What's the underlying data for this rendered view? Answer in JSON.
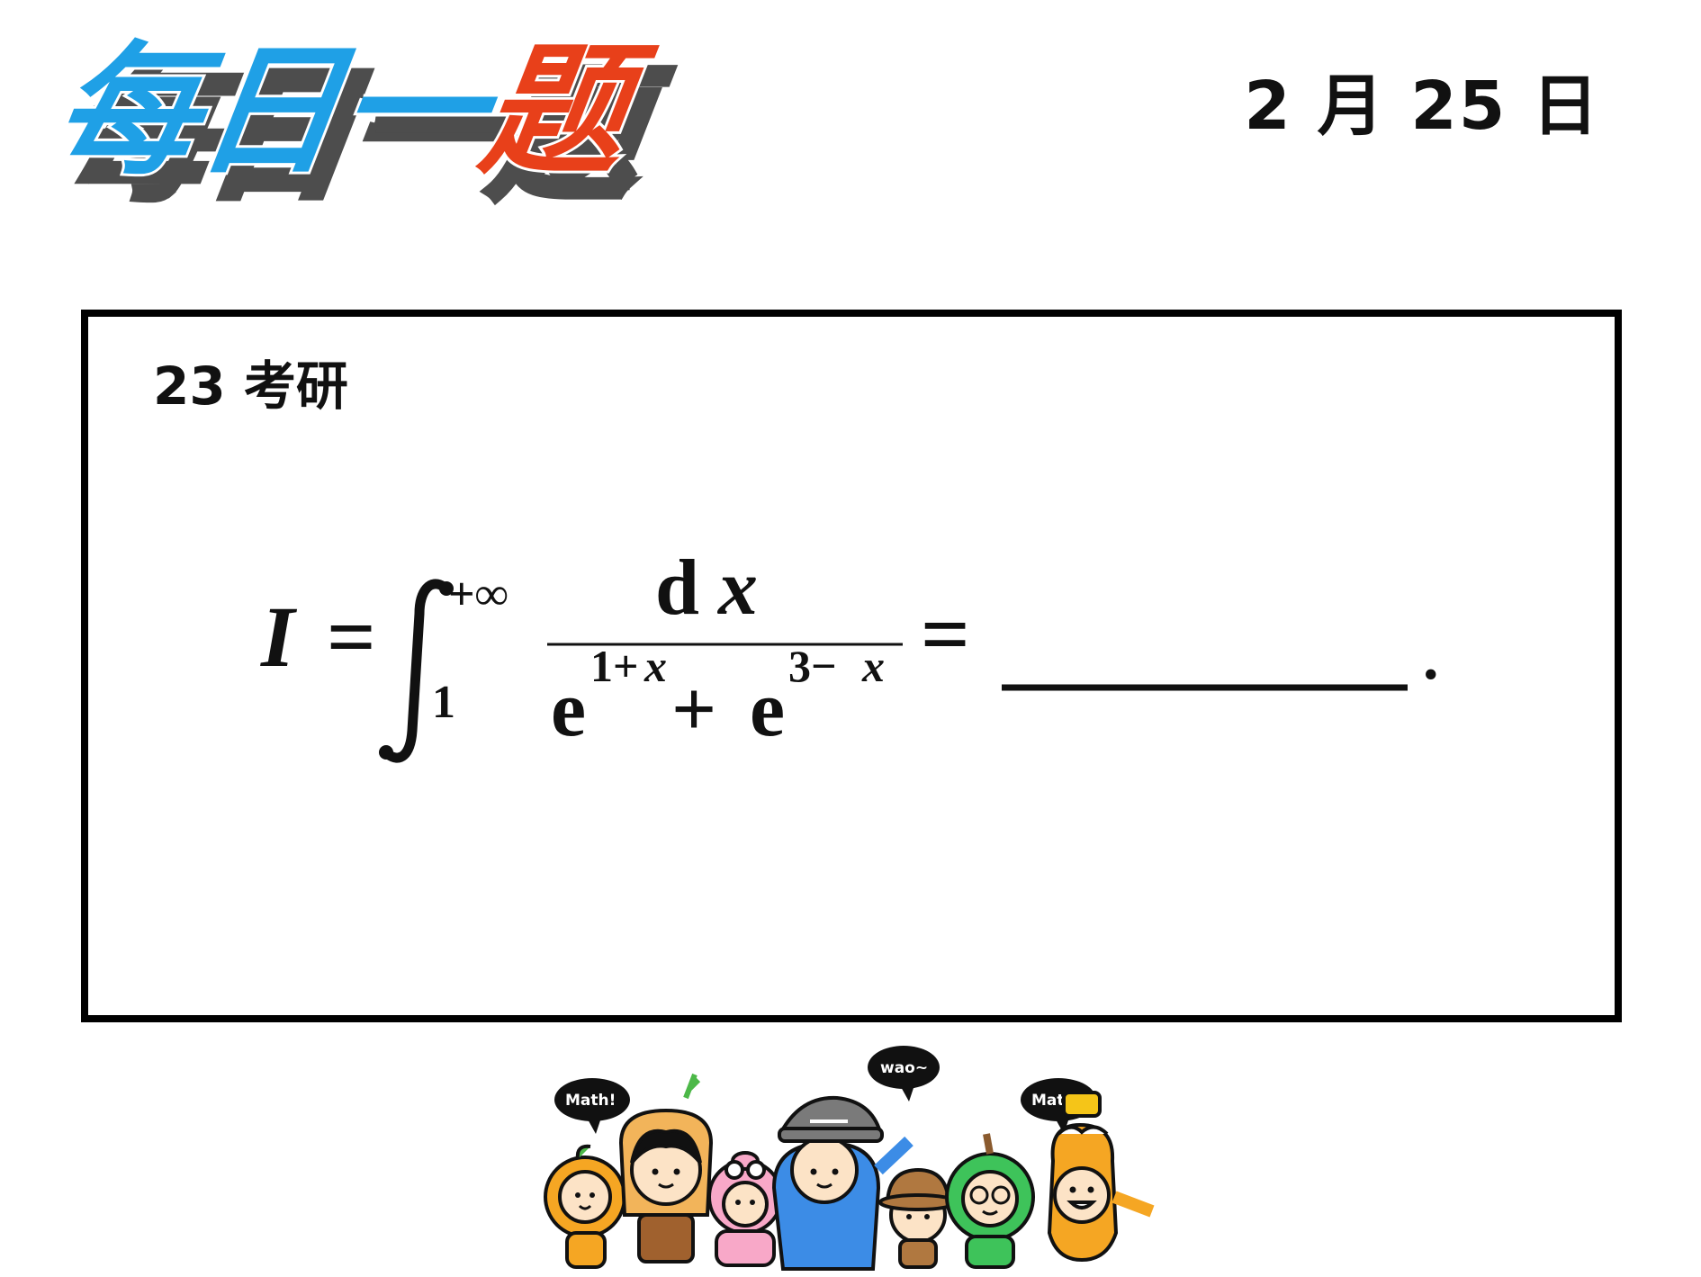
{
  "header": {
    "logo_text": "每日一题",
    "logo_colors": {
      "blue": "#1FA0E6",
      "red": "#E8401A",
      "shadow": "#4d4d4d"
    },
    "date": "2 月 25 日"
  },
  "question": {
    "source": "23 考研",
    "formula": {
      "lhs": "I",
      "equals": "=",
      "integral_upper": "+∞",
      "integral_lower": "1",
      "numerator_d": "d",
      "numerator_x": "x",
      "den_e1": "e",
      "den_exp1_num": "1+",
      "den_exp1_var": "x",
      "den_plus": "+",
      "den_e2": "e",
      "den_exp2_num": "3−",
      "den_exp2_var": "x",
      "equals2": "=",
      "period": "."
    }
  },
  "mascots": {
    "bubbles": [
      "Math!",
      "wao~",
      "Math!"
    ]
  }
}
